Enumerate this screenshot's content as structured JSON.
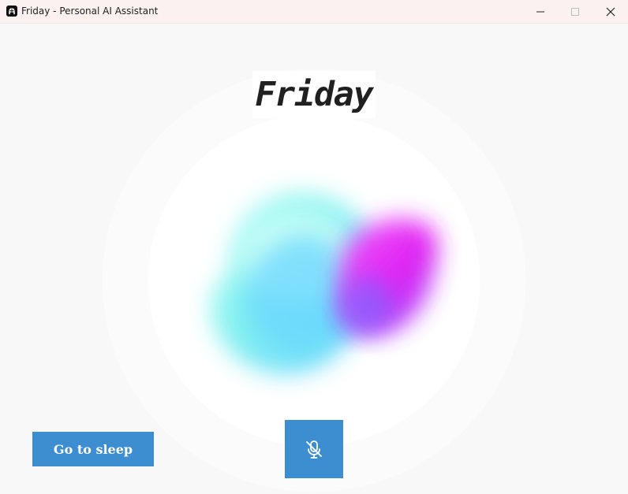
{
  "window": {
    "title": "Friday - Personal AI Assistant",
    "app_icon": "app-helmet-icon",
    "controls": {
      "minimize_icon": "minimize-icon",
      "maximize_icon": "maximize-icon",
      "close_icon": "close-icon"
    }
  },
  "main": {
    "assistant_name": "Friday",
    "orb": {
      "icon": "assistant-orb",
      "colors": [
        "#7ff4ef",
        "#6ad8ff",
        "#9ef0f0",
        "#e31cf2",
        "#8a5cff"
      ]
    },
    "actions": {
      "sleep_label": "Go to sleep",
      "mic_icon": "mic-off-icon"
    }
  },
  "colors": {
    "button_blue": "#3d8ed0",
    "background": "#f8f8f9",
    "titlebar": "#fbf1f1"
  }
}
